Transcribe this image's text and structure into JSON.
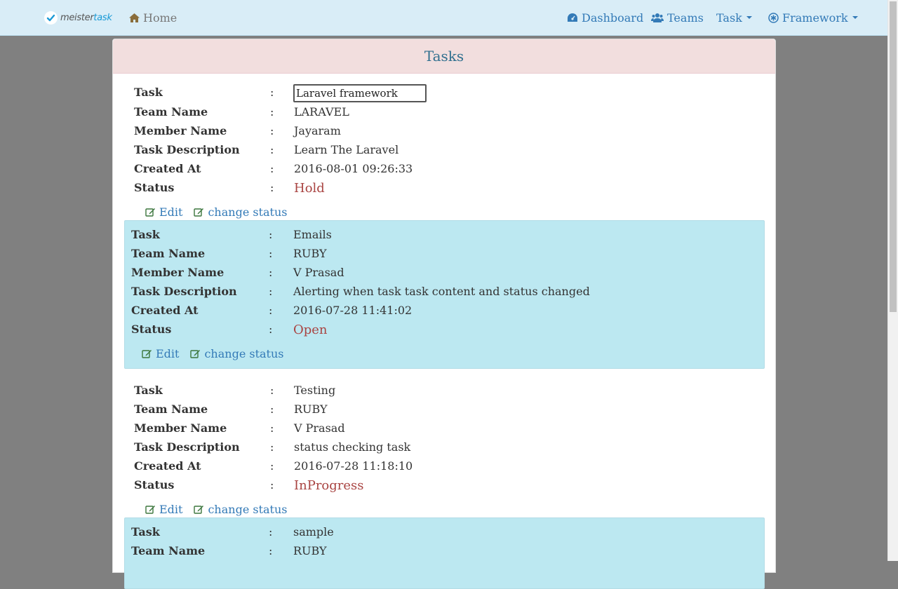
{
  "brand": {
    "prefix": "meister",
    "suffix": "task"
  },
  "nav": {
    "home": "Home",
    "dashboard": "Dashboard",
    "teams": "Teams",
    "task": "Task",
    "framework": "Framework"
  },
  "colors": {
    "navbar": "#d9edf7",
    "heading": "#f2dede",
    "info": "#bce8f1",
    "status": "#a94442",
    "link": "#337ab7"
  },
  "panel": {
    "title": "Tasks"
  },
  "labels": {
    "task": "Task",
    "team": "Team Name",
    "member": "Member Name",
    "description": "Task Description",
    "created": "Created At",
    "status": "Status",
    "colon": ":",
    "edit": "Edit",
    "change_status": "change status"
  },
  "tasks": [
    {
      "task": "Laravel framework",
      "team": "LARAVEL",
      "member": "Jayaram",
      "description": "Learn The Laravel",
      "created": "2016-08-01 09:26:33",
      "status": "Hold"
    },
    {
      "task": "Emails",
      "team": "RUBY",
      "member": "V Prasad",
      "description": "Alerting when task task content and status changed",
      "created": "2016-07-28 11:41:02",
      "status": "Open"
    },
    {
      "task": "Testing",
      "team": "RUBY",
      "member": "V Prasad",
      "description": "status checking task",
      "created": "2016-07-28 11:18:10",
      "status": "InProgress"
    },
    {
      "task": "sample",
      "team": "RUBY"
    }
  ]
}
